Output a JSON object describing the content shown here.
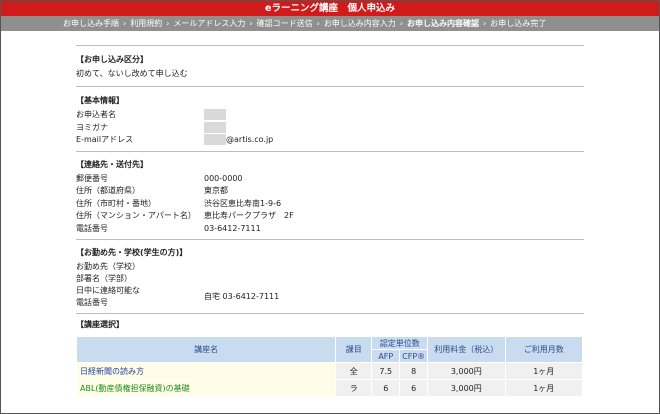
{
  "title": "eラーニング講座　個人申込み",
  "steps": [
    "お申し込み手順",
    "利用規約",
    "メールアドレス入力",
    "確認コード送信",
    "お申し込み内容入力",
    "お申し込み内容確認",
    "お申し込み完了"
  ],
  "step_sep": "›",
  "current_step_index": 5,
  "sections": {
    "kubun": {
      "title": "【お申し込み区分】",
      "value": "初めて、ないし改めて申し込む"
    },
    "kihon": {
      "title": "【基本情報】",
      "name_label": "お申込者名",
      "kana_label": "ヨミガナ",
      "email_label": "E-mailアドレス",
      "email_domain": "@artis.co.jp"
    },
    "renraku": {
      "title": "【連絡先・送付先】",
      "fields": [
        {
          "label": "郵便番号",
          "value": "000-0000"
        },
        {
          "label": "住所（都道府県）",
          "value": "東京都"
        },
        {
          "label": "住所（市町村・番地）",
          "value": "渋谷区恵比寿南1-9-6"
        },
        {
          "label": "住所（マンション・アパート名）",
          "value": "恵比寿パークプラザ　2F"
        },
        {
          "label": "電話番号",
          "value": "03-6412-7111"
        }
      ]
    },
    "kinmu": {
      "title": "【お勤め先・学校(学生の方)】",
      "company_label": "お勤め先（学校）",
      "dept_label": "部署名（学部）",
      "phone_label_1": "日中に連絡可能な",
      "phone_label_2": "電話番号",
      "phone_value": "自宅 03-6412-7111"
    },
    "kouza": {
      "title": "【講座選択】",
      "headers": {
        "name": "講座名",
        "kamoku": "課目",
        "credits": "認定単位数",
        "afp": "AFP",
        "cfp": "CFP®",
        "fee": "利用料金（税込）",
        "period": "ご利用月数"
      },
      "rows": [
        {
          "name": "日経新聞の読み方",
          "kamoku": "全",
          "afp": "7.5",
          "cfp": "8",
          "fee": "3,000円",
          "period": "1ヶ月"
        },
        {
          "name": "ABL(動産債権担保融資)の基礎",
          "kamoku": "ラ",
          "afp": "6",
          "cfp": "6",
          "fee": "3,000円",
          "period": "1ヶ月"
        }
      ]
    }
  }
}
